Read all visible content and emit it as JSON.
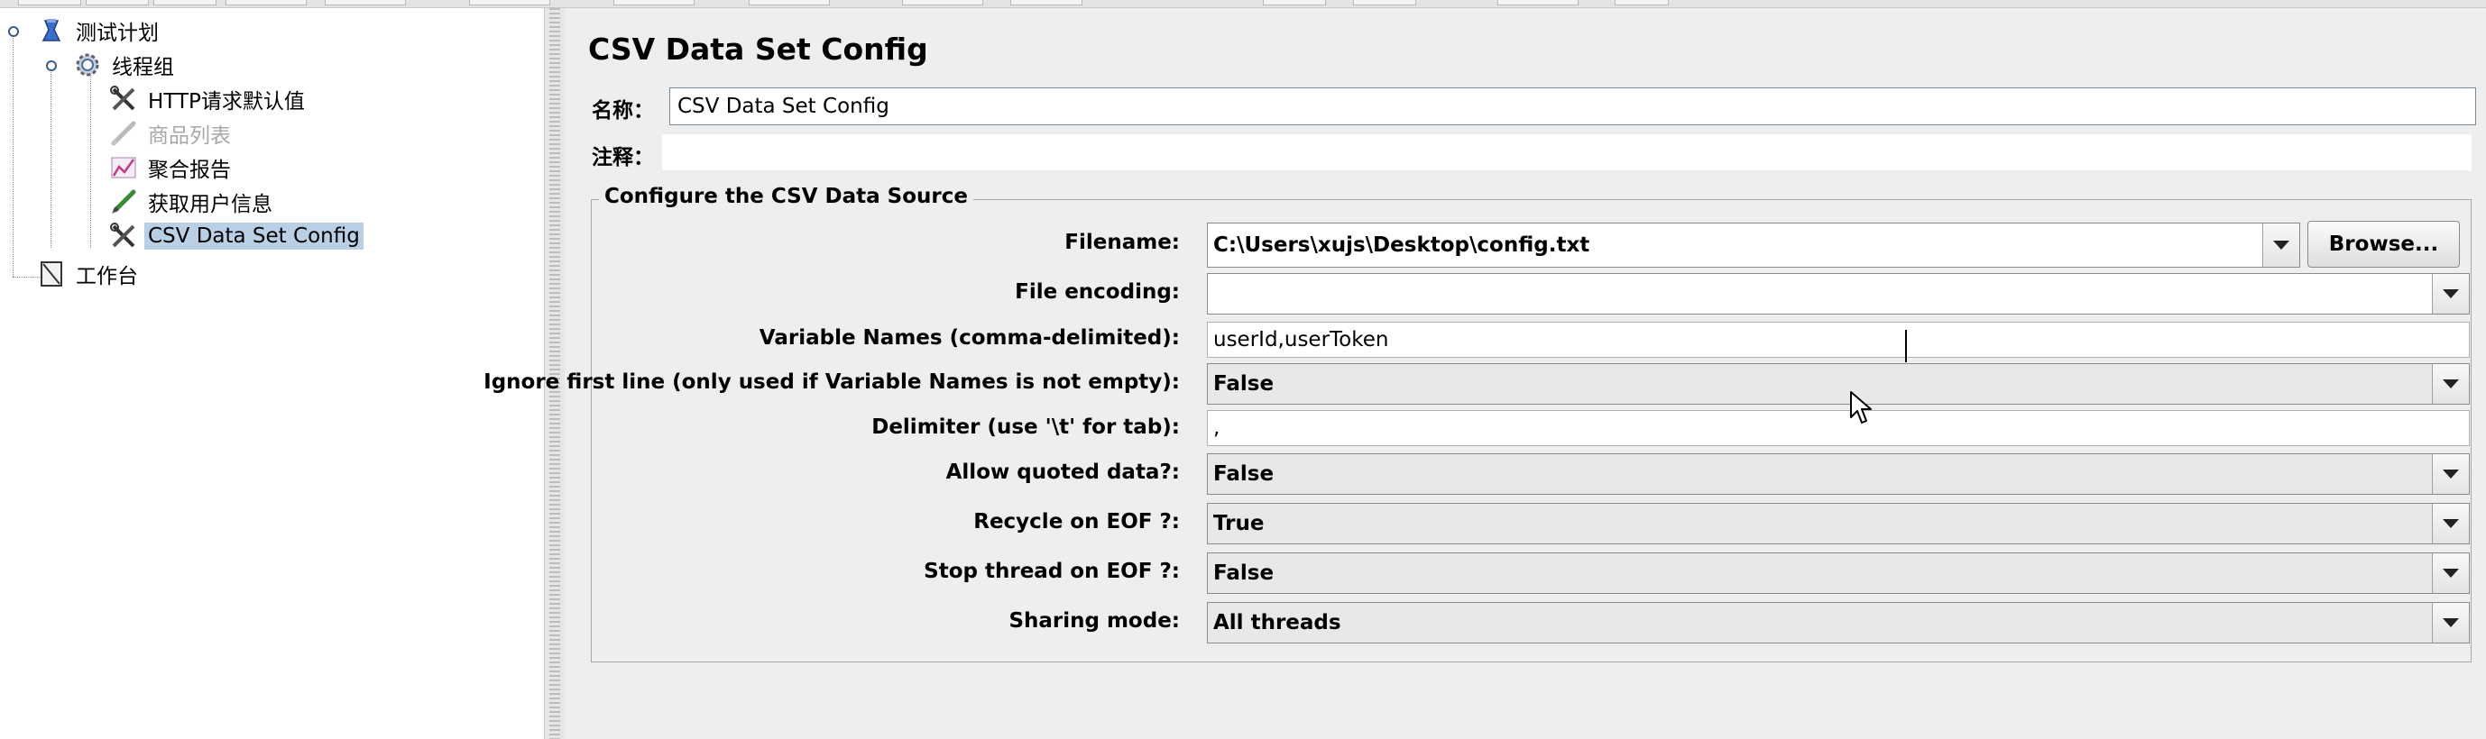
{
  "tree": {
    "items": [
      {
        "label": "测试计划",
        "icon": "test-plan-icon"
      },
      {
        "label": "线程组",
        "icon": "thread-group-gear-icon"
      },
      {
        "label": "HTTP请求默认值",
        "icon": "config-wrench-icon"
      },
      {
        "label": "商品列表",
        "icon": "sampler-pencil-icon",
        "disabled": true
      },
      {
        "label": "聚合报告",
        "icon": "listener-chart-icon"
      },
      {
        "label": "获取用户信息",
        "icon": "sampler-pencil-icon"
      },
      {
        "label": "CSV Data Set Config",
        "icon": "config-wrench-icon",
        "selected": true
      },
      {
        "label": "工作台",
        "icon": "workbench-icon"
      }
    ]
  },
  "panel": {
    "title": "CSV Data Set Config",
    "name_label": "名称：",
    "name_value": "CSV Data Set Config",
    "comment_label": "注释：",
    "comment_value": ""
  },
  "csv_source": {
    "group_title": "Configure the CSV Data Source",
    "filename_label": "Filename:",
    "filename_value": "C:\\Users\\xujs\\Desktop\\config.txt",
    "browse_label": "Browse...",
    "encoding_label": "File encoding:",
    "encoding_value": "",
    "variable_names_label": "Variable Names (comma-delimited):",
    "variable_names_value": "userId,userToken",
    "ignore_first_line_label": "Ignore first line (only used if Variable Names is not empty):",
    "ignore_first_line_value": "False",
    "delimiter_label": "Delimiter (use '\\t' for tab):",
    "delimiter_value": ",",
    "quoted_data_label": "Allow quoted data?:",
    "quoted_data_value": "False",
    "recycle_label": "Recycle on EOF ?:",
    "recycle_value": "True",
    "stop_thread_label": "Stop thread on EOF ?:",
    "stop_thread_value": "False",
    "sharing_label": "Sharing mode:",
    "sharing_value": "All threads"
  },
  "colors": {
    "selection": "#b8cfe5",
    "panel_bg": "#eeeeee"
  }
}
